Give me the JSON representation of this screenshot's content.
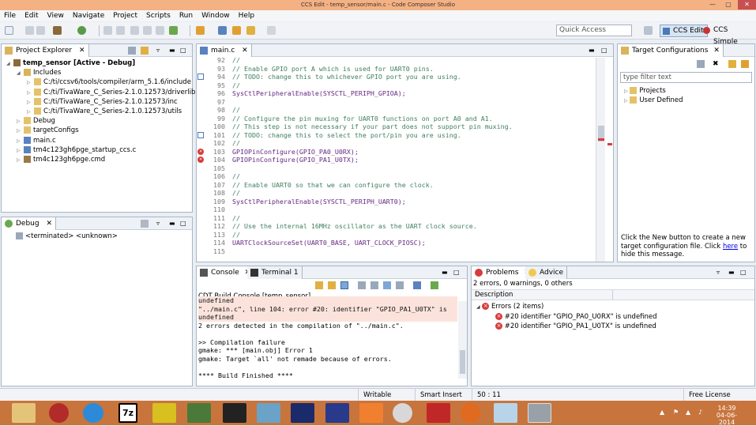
{
  "window": {
    "title": "CCS Edit - temp_sensor/main.c - Code Composer Studio"
  },
  "menu": [
    "File",
    "Edit",
    "View",
    "Navigate",
    "Project",
    "Scripts",
    "Run",
    "Window",
    "Help"
  ],
  "quick_access": {
    "placeholder": "Quick Access"
  },
  "perspectives": {
    "edit": "CCS Edit",
    "simple": "CCS Simple"
  },
  "project_explorer": {
    "title": "Project Explorer",
    "items": [
      {
        "label": "temp_sensor  [Active - Debug]",
        "level": 0,
        "icon": "project-icon"
      },
      {
        "label": "Includes",
        "level": 1,
        "icon": "includes-icon"
      },
      {
        "label": "C:/ti/ccsv6/tools/compiler/arm_5.1.6/include",
        "level": 2,
        "icon": "folder-icon"
      },
      {
        "label": "C:/ti/TivaWare_C_Series-2.1.0.12573/driverlib",
        "level": 2,
        "icon": "folder-icon"
      },
      {
        "label": "C:/ti/TivaWare_C_Series-2.1.0.12573/inc",
        "level": 2,
        "icon": "folder-icon"
      },
      {
        "label": "C:/ti/TivaWare_C_Series-2.1.0.12573/utils",
        "level": 2,
        "icon": "folder-icon"
      },
      {
        "label": "Debug",
        "level": 1,
        "icon": "folder-icon"
      },
      {
        "label": "targetConfigs",
        "level": 1,
        "icon": "folder-icon"
      },
      {
        "label": "main.c",
        "level": 1,
        "icon": "c-file-icon"
      },
      {
        "label": "tm4c123gh6pge_startup_ccs.c",
        "level": 1,
        "icon": "c-file-icon"
      },
      {
        "label": "tm4c123gh6pge.cmd",
        "level": 1,
        "icon": "cmd-file-icon"
      }
    ]
  },
  "debug_view": {
    "title": "Debug",
    "items": [
      "<terminated> <unknown>"
    ]
  },
  "editor": {
    "tab": "main.c",
    "lines": [
      {
        "n": "92",
        "text": "//",
        "kind": "cmt",
        "marker": ""
      },
      {
        "n": "93",
        "text": "// Enable GPIO port A which is used for UART0 pins.",
        "kind": "cmt",
        "marker": ""
      },
      {
        "n": "94",
        "text": "// TODO: change this to whichever GPIO port you are using.",
        "kind": "cmt",
        "marker": "task"
      },
      {
        "n": "95",
        "text": "//",
        "kind": "cmt",
        "marker": ""
      },
      {
        "n": "96",
        "text": "SysCtlPeripheralEnable(SYSCTL_PERIPH_GPIOA);",
        "kind": "fn",
        "marker": ""
      },
      {
        "n": "97",
        "text": "",
        "kind": "pl",
        "marker": ""
      },
      {
        "n": "98",
        "text": "//",
        "kind": "cmt",
        "marker": ""
      },
      {
        "n": "99",
        "text": "// Configure the pin muxing for UART0 functions on port A0 and A1.",
        "kind": "cmt",
        "marker": ""
      },
      {
        "n": "100",
        "text": "// This step is not necessary if your part does not support pin muxing.",
        "kind": "cmt",
        "marker": ""
      },
      {
        "n": "101",
        "text": "// TODO: change this to select the port/pin you are using.",
        "kind": "cmt",
        "marker": "task"
      },
      {
        "n": "102",
        "text": "//",
        "kind": "cmt",
        "marker": ""
      },
      {
        "n": "103",
        "text": "GPIOPinConfigure(GPIO_PA0_U0RX);",
        "kind": "fn",
        "marker": "error"
      },
      {
        "n": "104",
        "text": "GPIOPinConfigure(GPIO_PA1_U0TX);",
        "kind": "fn",
        "marker": "error"
      },
      {
        "n": "105",
        "text": "",
        "kind": "pl",
        "marker": ""
      },
      {
        "n": "106",
        "text": "//",
        "kind": "cmt",
        "marker": ""
      },
      {
        "n": "107",
        "text": "// Enable UART0 so that we can configure the clock.",
        "kind": "cmt",
        "marker": ""
      },
      {
        "n": "108",
        "text": "//",
        "kind": "cmt",
        "marker": ""
      },
      {
        "n": "109",
        "text": "SysCtlPeripheralEnable(SYSCTL_PERIPH_UART0);",
        "kind": "fn",
        "marker": ""
      },
      {
        "n": "110",
        "text": "",
        "kind": "pl",
        "marker": ""
      },
      {
        "n": "111",
        "text": "//",
        "kind": "cmt",
        "marker": ""
      },
      {
        "n": "112",
        "text": "// Use the internal 16MHz oscillator as the UART clock source.",
        "kind": "cmt",
        "marker": ""
      },
      {
        "n": "113",
        "text": "//",
        "kind": "cmt",
        "marker": ""
      },
      {
        "n": "114",
        "text": "UARTClockSourceSet(UART0_BASE, UART_CLOCK_PIOSC);",
        "kind": "fn",
        "marker": ""
      },
      {
        "n": "115",
        "text": "",
        "kind": "pl",
        "marker": ""
      }
    ]
  },
  "target_config": {
    "title": "Target Configurations",
    "filter_placeholder": "type filter text",
    "items": [
      "Projects",
      "User Defined"
    ],
    "message_pre": "Click the New button to create a new target configuration file. Click ",
    "message_link": "here",
    "message_post": " to hide this message."
  },
  "console": {
    "tabs": [
      "Console",
      "Terminal 1"
    ],
    "header": "CDT Build Console [temp_sensor]",
    "lines": [
      {
        "text": "undefined",
        "error": true
      },
      {
        "text": "\"../main.c\", line 104: error #20: identifier \"GPIO_PA1_U0TX\" is",
        "error": true
      },
      {
        "text": "undefined",
        "error": true
      },
      {
        "text": "2 errors detected in the compilation of \"../main.c\".",
        "error": false
      },
      {
        "text": "",
        "error": false
      },
      {
        "text": ">> Compilation failure",
        "error": false
      },
      {
        "text": "gmake: *** [main.obj] Error 1",
        "error": false
      },
      {
        "text": "gmake: Target `all' not remade because of errors.",
        "error": false
      },
      {
        "text": "",
        "error": false
      },
      {
        "text": "**** Build Finished ****",
        "error": false
      }
    ]
  },
  "problems": {
    "tabs": [
      "Problems",
      "Advice"
    ],
    "summary": "2 errors, 0 warnings, 0 others",
    "column": "Description",
    "group": "Errors (2 items)",
    "items": [
      "#20 identifier \"GPIO_PA0_U0RX\" is undefined",
      "#20 identifier \"GPIO_PA1_U0TX\" is undefined"
    ]
  },
  "status": {
    "mode": "Writable",
    "insert": "Smart Insert",
    "position": "50 : 11",
    "license": "Free License"
  },
  "taskbar": {
    "time": "14:39",
    "date": "04-06-2014"
  },
  "colors": {
    "titlebar": "#f4b183",
    "taskbar": "#c8743d",
    "comment": "#3f7f5f",
    "function": "#642880",
    "error": "#d83b3b"
  }
}
